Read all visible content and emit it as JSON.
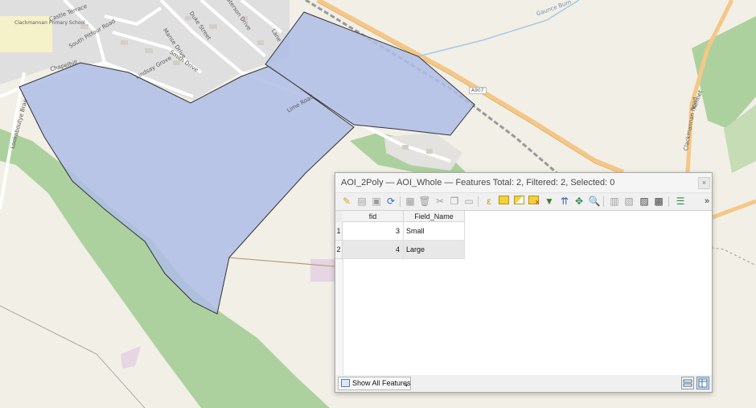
{
  "map": {
    "labels": {
      "school": "Clackmannan Primary School",
      "castle_terrace": "Castle Terrace",
      "south_pitfour": "South Pitfour Road",
      "chapelhill": "Chapelhill",
      "manse_drive": "Manse Drive",
      "duke_street": "Duke Street",
      "smith_drive": "Smith Drive",
      "lindsay_grove": "Lindsay Grove",
      "lime_road": "Lime Road",
      "paterson": "Paterson Drive",
      "lookaboutye": "Lookaboutye Brae",
      "a907": "A907",
      "clackmannan_road": "Clackmannan Road",
      "gaunce_burn": "Gaunce Burn",
      "lame": "Lane",
      "kennet": "Kennet"
    },
    "colors": {
      "background": "#f2efe6",
      "polygon_fill": "#aebde6",
      "polygon_stroke": "#333333",
      "woodland": "#add19e",
      "road_major": "#f5c787",
      "residential": "#e0dfdf"
    }
  },
  "window": {
    "title": "AOI_2Poly — AOI_Whole — Features Total: 2, Filtered: 2, Selected: 0",
    "close_glyph": "×",
    "toolbar": {
      "overflow": "»"
    },
    "table": {
      "columns": [
        "fid",
        "Field_Name"
      ],
      "rows": [
        {
          "index": "1",
          "fid": "3",
          "field_name": "Small"
        },
        {
          "index": "2",
          "fid": "4",
          "field_name": "Large"
        }
      ]
    },
    "bottom": {
      "show_all_label": "Show All Features",
      "dropdown_glyph": "▾"
    }
  }
}
